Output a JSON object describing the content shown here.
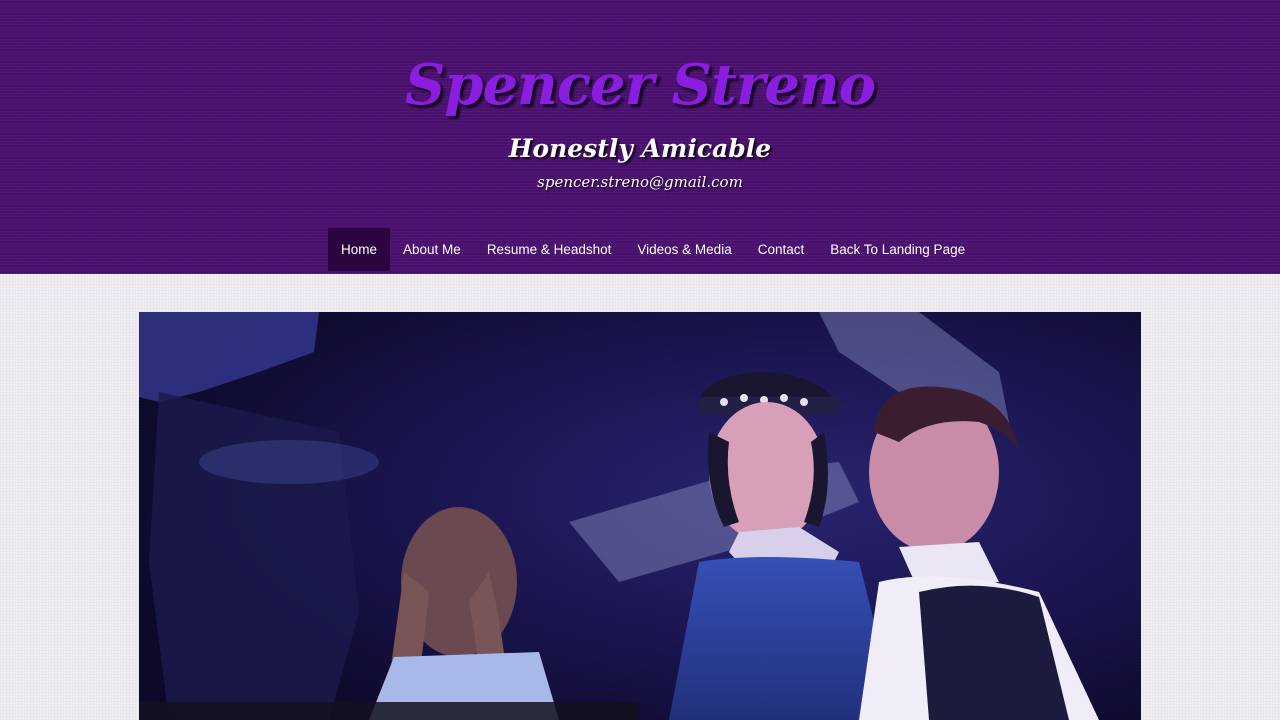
{
  "header": {
    "title": "Spencer Streno",
    "tagline": "Honestly Amicable",
    "email": "spencer.streno@gmail.com"
  },
  "nav": {
    "items": [
      {
        "label": "Home",
        "active": true
      },
      {
        "label": "About Me",
        "active": false
      },
      {
        "label": "Resume & Headshot",
        "active": false
      },
      {
        "label": "Videos & Media",
        "active": false
      },
      {
        "label": "Contact",
        "active": false
      },
      {
        "label": "Back To Landing Page",
        "active": false
      }
    ]
  },
  "colors": {
    "header_bg": "#4b1170",
    "title": "#8a1ee0",
    "nav_active_bg": "#2c0540",
    "page_bg": "#f0eef2"
  }
}
